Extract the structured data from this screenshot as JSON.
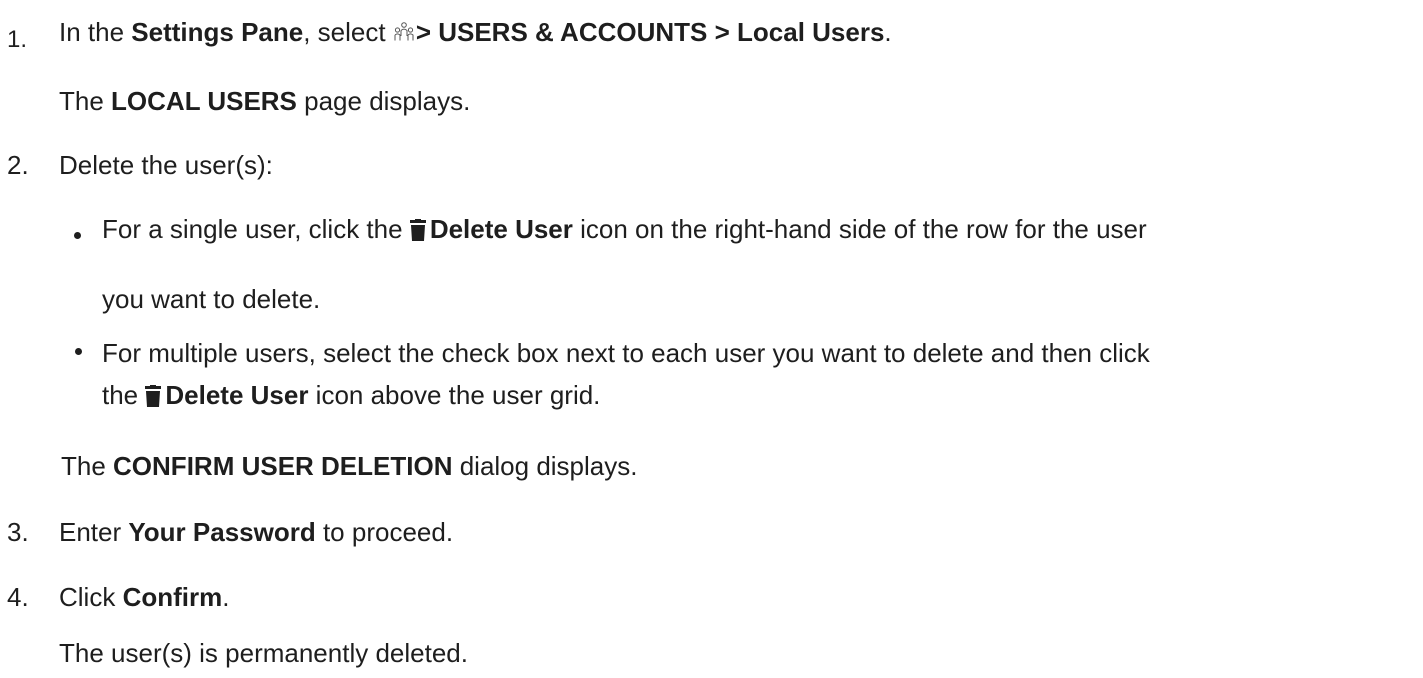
{
  "steps": [
    {
      "number": "1.",
      "parts": {
        "a": "In the ",
        "b": "Settings Pane",
        "c": ", select ",
        "d": "> USERS & ACCOUNTS > Local Users",
        "e": "."
      },
      "result": {
        "a": "The ",
        "b": "LOCAL USERS",
        "c": " page displays."
      }
    },
    {
      "number": "2.",
      "text": "Delete the user(s):",
      "bullets": [
        {
          "line1": {
            "a": "For a single user, click the ",
            "b": "Delete User",
            "c": " icon on the right-hand side of the row for the user"
          },
          "line2": "you want to delete."
        },
        {
          "line1": "For multiple users, select the check box next to each user you want to delete and then click",
          "line2": {
            "a": "the ",
            "b": "Delete User",
            "c": " icon above the user grid."
          }
        }
      ],
      "result": {
        "a": "The ",
        "b": "CONFIRM USER DELETION",
        "c": " dialog displays."
      }
    },
    {
      "number": "3.",
      "parts": {
        "a": "Enter ",
        "b": "Your Password",
        "c": " to proceed."
      }
    },
    {
      "number": "4.",
      "parts": {
        "a": "Click ",
        "b": "Confirm",
        "c": "."
      },
      "result": "The user(s) is permanently deleted."
    }
  ],
  "icons": {
    "users": "users-icon",
    "trash": "trash-icon"
  },
  "colors": {
    "text": "#1e1e1e",
    "background": "#ffffff"
  }
}
